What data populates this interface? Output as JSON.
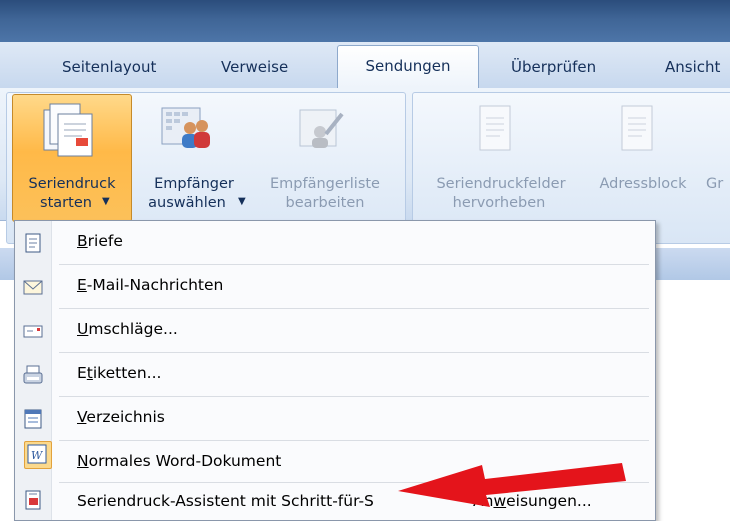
{
  "ribbon_tabs": {
    "layout": "Seitenlayout",
    "references": "Verweise",
    "mailings": "Sendungen",
    "review": "Überprüfen",
    "view": "Ansicht"
  },
  "ribbon": {
    "start_mailmerge": {
      "line1": "Seriendruck",
      "line2": "starten"
    },
    "select_recipients": {
      "line1": "Empfänger",
      "line2": "auswählen"
    },
    "edit_list": {
      "line1": "Empfängerliste",
      "line2": "bearbeiten"
    },
    "highlight_fields": {
      "line1": "Seriendruckfelder",
      "line2": "hervorheben"
    },
    "address_block": "Adressblock",
    "greeting_partial": "Gr"
  },
  "menu": {
    "items": [
      {
        "pre": "",
        "u": "B",
        "post": "riefe",
        "icon": "letter-icon"
      },
      {
        "pre": "",
        "u": "E",
        "post": "-Mail-Nachrichten",
        "icon": "email-icon"
      },
      {
        "pre": "",
        "u": "U",
        "post": "mschläge...",
        "icon": "envelope-icon"
      },
      {
        "pre": "E",
        "u": "t",
        "post": "iketten...",
        "icon": "label-icon"
      },
      {
        "pre": "",
        "u": "V",
        "post": "erzeichnis",
        "icon": "directory-icon"
      },
      {
        "pre": "",
        "u": "N",
        "post": "ormales Word-Dokument",
        "icon": "word-document-icon"
      },
      {
        "pre": "Seriendruck-Assistent mit Schritt-für-S",
        "u": "",
        "post": "",
        "icon": "wizard-icon"
      }
    ],
    "wizard_tail": {
      "pre": "An",
      "u": "w",
      "post": "eisungen..."
    }
  },
  "colors": {
    "accent_orange": "#ffb948",
    "ribbon_blue": "#dde8f5",
    "arrow_red": "#e4141b"
  }
}
